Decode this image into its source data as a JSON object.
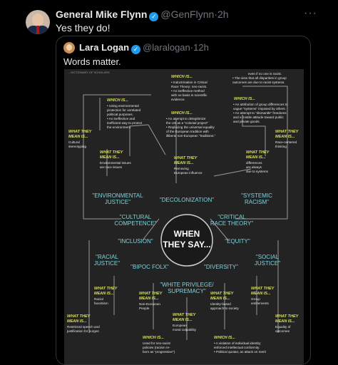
{
  "tweet": {
    "name": "General Mike Flynn",
    "handle": "@GenFlynn",
    "time": "2h",
    "text": "Yes they do!",
    "more": "···",
    "sep": "·"
  },
  "quote": {
    "name": "Lara Logan",
    "handle": "@laralogan",
    "time": "12h",
    "text": "Words matter."
  },
  "graphic": {
    "banner": "...DICTIONARY OF SCHOLARS",
    "center": [
      "WHEN",
      "THEY SAY..."
    ],
    "which_is": "WHICH IS...",
    "they_mean": [
      "WHAT THEY",
      "MEAN IS..."
    ],
    "terms": {
      "environmental": [
        "\"ENVIRONMENTAL",
        "JUSTICE\""
      ],
      "decolonization": "\"DECOLONIZATION\"",
      "systemic": [
        "\"SYSTEMIC",
        "RACISM\""
      ],
      "cultural": [
        "\"CULTURAL",
        "COMPETENCE\""
      ],
      "critical": [
        "\"CRITICAL",
        "RACE THEORY\""
      ],
      "inclusion": "\"INCLUSION\"",
      "equity": "\"EQUITY\"",
      "racial": [
        "\"RACIAL",
        "JUSTICE\""
      ],
      "bipoc": "\"BIPOC FOLX\"",
      "diversity": "\"DIVERSITY\"",
      "social": [
        "\"SOCIAL",
        "JUSTICE\""
      ],
      "white": [
        "\"WHITE PRIVILEGE/",
        "SUPREMACY\""
      ]
    },
    "which_texts": {
      "top_center": [
        "• Indoctrination in Critical",
        "Race Theory; neo-racist.",
        "• An ineffective method",
        "with no basis in scientific",
        "evidence."
      ],
      "top_right": [
        "even if no one is racist.",
        "• The view that all disparities in group",
        "outcomes are due to racist systems."
      ],
      "left_mid": [
        "• Using environmental",
        "protection for unrelated",
        "political purposes.",
        "• An ineffective and",
        "inefficient way to protect",
        "the environment."
      ],
      "center_mid": [
        "• An attempt to delegitimize",
        "the US as a \"colonial project\"",
        "• Replacing the universal equality",
        "of the European tradition with",
        "illiberal non-European \"traditions.\""
      ],
      "right_mid": [
        "• An attribution of group differences to",
        "vague \"systems\" imposed by others.",
        "• An attempt to \"dismantle\" freedoms",
        "and a hostile attitude toward public",
        "and private goods."
      ],
      "bottom_left": [
        "Used for neo-racist",
        "policies (racism re-",
        "born as \"progressive\")"
      ],
      "bottom_center": [
        "• A violation of individual identity;",
        "enforced intellectual conformity.",
        "• Political quotas; an attack on merit"
      ]
    },
    "mean_texts": {
      "cultural_stereo": [
        "Cultural",
        "stereotyping"
      ],
      "env_issues": [
        "Environmental issues",
        "are race issues"
      ],
      "removing": [
        "Removing",
        "European influence"
      ],
      "differences": [
        "differences",
        "are always",
        "due to systems"
      ],
      "race_centered": [
        "Race-centered",
        "thinking"
      ],
      "racial_fav": [
        "Racial",
        "favoritism"
      ],
      "restricted": [
        "Restricted speech and",
        "justification for purges"
      ],
      "non_european": [
        "Non-European",
        "People"
      ],
      "european_culp": [
        "European",
        "moral culpability"
      ],
      "identity": [
        "Identity-based",
        "approach to society"
      ],
      "group_ent": [
        "Group",
        "entitlements"
      ],
      "equality": [
        "Equality of",
        "outcomes"
      ]
    }
  },
  "colors": {
    "bg": "#000000",
    "graphic_bg": "#232323",
    "yellow": "#d9e05a",
    "teal": "#7fd4dc",
    "line": "#9a9a9a",
    "verified": "#1d9bf0"
  }
}
